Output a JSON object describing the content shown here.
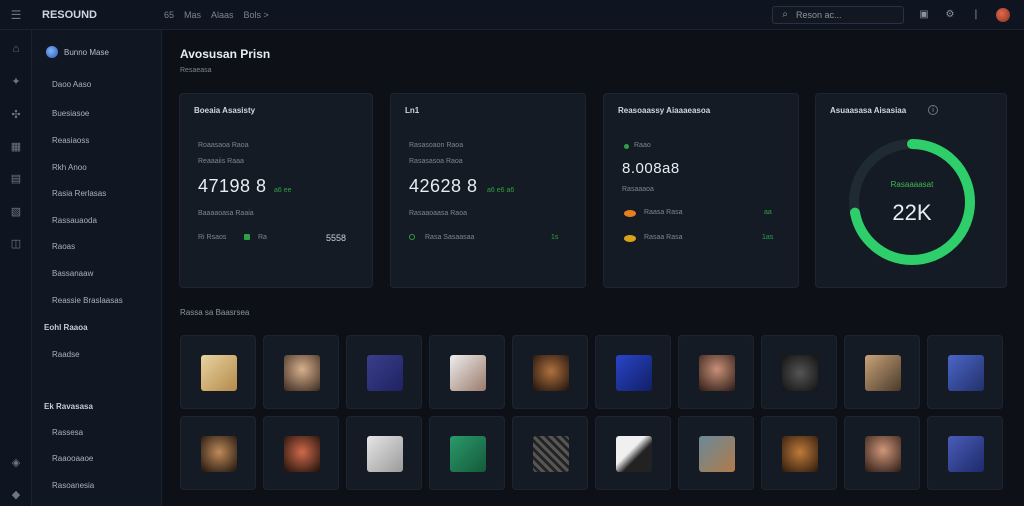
{
  "topbar": {
    "brand": "RESOUND",
    "crumbs": [
      "65",
      "Mas",
      "Alaas",
      "Bols >"
    ],
    "search_placeholder": "Reson ac..."
  },
  "sidebar": {
    "workspace": "Bunno Mase",
    "items": [
      "Daoo Aaso",
      "Buesiasoe",
      "Reasiaoss",
      "Rkh Anoo",
      "Rasia Rerlasas",
      "Rassauaoda",
      "Raoas",
      "Bassanaaw",
      "Reassie Braslaasas"
    ],
    "section1": "Eohl Raaoa",
    "section1_items": [
      "Raadse"
    ],
    "section2": "Ek Ravasasa",
    "section2_items": [
      "Rassesa",
      "Raaooaaoe",
      "Rasoanesia"
    ]
  },
  "main": {
    "title": "Avosusan Prisn",
    "subtitle": "Resaeasa"
  },
  "cards": [
    {
      "title": "Boeaia Asasisty",
      "line1": "Roaasaoa Raoa",
      "line2": "Reaaaiis Raaa",
      "value": "47198 8",
      "delta": "a6 ee",
      "line3": "Baaaaoasa Raaia",
      "row_left": "Ri Rsaos",
      "row_mid": "Ra",
      "row_value": "5558"
    },
    {
      "title": "Ln1",
      "line1": "Rasasoaon Raoa",
      "line2": "Rasasasoa Raoa",
      "value": "42628 8",
      "delta": "a6 e6 a6",
      "line3": "Rasaaoaasa Raoa",
      "row_left": "Rasa Sasaasaa",
      "row_value": "1s"
    },
    {
      "title": "Reasoaassy Aiaaaeasoa",
      "line1": "Raao",
      "value": "8.008a8",
      "line2": "Rasaaaoa",
      "rows": [
        {
          "label": "Raasa Rasa",
          "value": "aa"
        },
        {
          "label": "Rasaa Rasa",
          "value": "1as"
        }
      ]
    },
    {
      "title": "Asuaasasa Aisasiaa",
      "ring_label": "Rasaaaasat",
      "ring_value": "22K",
      "ring_fraction": 0.72
    }
  ],
  "gallery": {
    "title": "Rassa sa Baasrsea"
  },
  "colors": {
    "accent_green": "#2ea043",
    "ring_green": "#2ecf6a",
    "orange_dot": "#e5801f",
    "yellow_dot": "#d9a21a"
  }
}
